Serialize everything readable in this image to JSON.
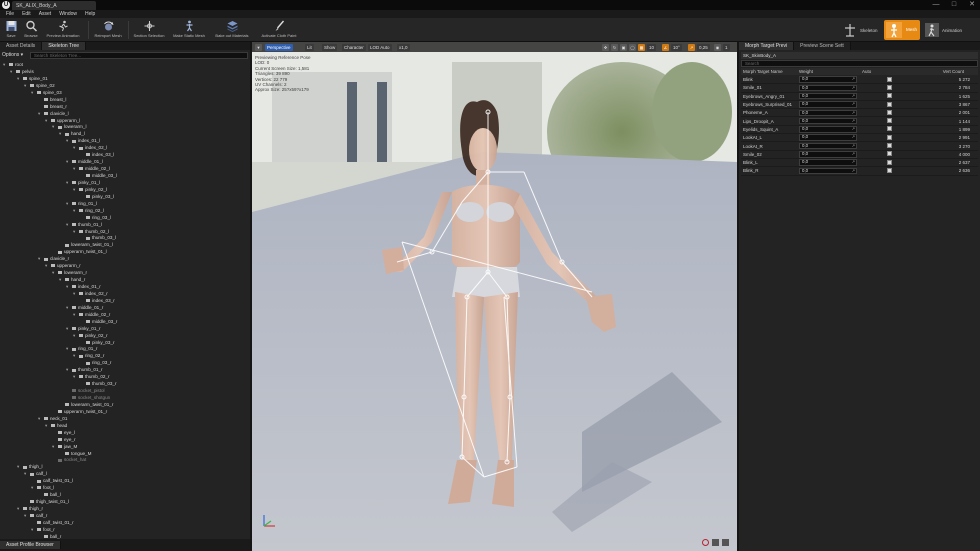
{
  "app": {
    "logo_letter": "U",
    "document_tab": "SK_ALIX_Body_A"
  },
  "menu": [
    "File",
    "Edit",
    "Asset",
    "Window",
    "Help"
  ],
  "toolbar": {
    "buttons": [
      "Save",
      "Browse",
      "Preview Animation",
      "Reimport Mesh",
      "Section Selection",
      "Make Static Mesh",
      "Bake out Materials",
      "Activate Cloth Paint"
    ],
    "modes": {
      "skeleton": "Skeleton",
      "mesh": "Mesh",
      "animation": "Animation"
    }
  },
  "left_panel": {
    "tabs": [
      "Asset Details",
      "Skeleton Tree"
    ],
    "options_label": "Options ▾",
    "search_placeholder": "Search Skeleton Tree...",
    "bottom_tab": "Asset Profile Browser",
    "tree": [
      {
        "label": "root",
        "depth": 0
      },
      {
        "label": "pelvis",
        "depth": 1
      },
      {
        "label": "spine_01",
        "depth": 2
      },
      {
        "label": "spine_02",
        "depth": 3
      },
      {
        "label": "spine_03",
        "depth": 4
      },
      {
        "label": "breast_l",
        "depth": 5
      },
      {
        "label": "breast_r",
        "depth": 5
      },
      {
        "label": "clavicle_l",
        "depth": 5
      },
      {
        "label": "upperarm_l",
        "depth": 6
      },
      {
        "label": "lowerarm_l",
        "depth": 7
      },
      {
        "label": "hand_l",
        "depth": 8
      },
      {
        "label": "index_01_l",
        "depth": 9
      },
      {
        "label": "index_02_l",
        "depth": 10
      },
      {
        "label": "index_03_l",
        "depth": 11
      },
      {
        "label": "middle_01_l",
        "depth": 9
      },
      {
        "label": "middle_02_l",
        "depth": 10
      },
      {
        "label": "middle_03_l",
        "depth": 11
      },
      {
        "label": "pinky_01_l",
        "depth": 9
      },
      {
        "label": "pinky_02_l",
        "depth": 10
      },
      {
        "label": "pinky_03_l",
        "depth": 11
      },
      {
        "label": "ring_01_l",
        "depth": 9
      },
      {
        "label": "ring_02_l",
        "depth": 10
      },
      {
        "label": "ring_03_l",
        "depth": 11
      },
      {
        "label": "thumb_01_l",
        "depth": 9
      },
      {
        "label": "thumb_02_l",
        "depth": 10
      },
      {
        "label": "thumb_03_l",
        "depth": 11
      },
      {
        "label": "lowerarm_twist_01_l",
        "depth": 8
      },
      {
        "label": "upperarm_twist_01_l",
        "depth": 7
      },
      {
        "label": "clavicle_r",
        "depth": 5
      },
      {
        "label": "upperarm_r",
        "depth": 6
      },
      {
        "label": "lowerarm_r",
        "depth": 7
      },
      {
        "label": "hand_r",
        "depth": 8
      },
      {
        "label": "index_01_r",
        "depth": 9
      },
      {
        "label": "index_02_r",
        "depth": 10
      },
      {
        "label": "index_03_r",
        "depth": 11
      },
      {
        "label": "middle_01_r",
        "depth": 9
      },
      {
        "label": "middle_02_r",
        "depth": 10
      },
      {
        "label": "middle_03_r",
        "depth": 11
      },
      {
        "label": "pinky_01_r",
        "depth": 9
      },
      {
        "label": "pinky_02_r",
        "depth": 10
      },
      {
        "label": "pinky_03_r",
        "depth": 11
      },
      {
        "label": "ring_01_r",
        "depth": 9
      },
      {
        "label": "ring_02_r",
        "depth": 10
      },
      {
        "label": "ring_03_r",
        "depth": 11
      },
      {
        "label": "thumb_01_r",
        "depth": 9
      },
      {
        "label": "thumb_02_r",
        "depth": 10
      },
      {
        "label": "thumb_03_r",
        "depth": 11
      },
      {
        "label": "socket_pistol",
        "depth": 9,
        "socket": true
      },
      {
        "label": "socket_shotgun",
        "depth": 9,
        "socket": true
      },
      {
        "label": "lowerarm_twist_01_r",
        "depth": 8
      },
      {
        "label": "upperarm_twist_01_r",
        "depth": 7
      },
      {
        "label": "neck_01",
        "depth": 5
      },
      {
        "label": "head",
        "depth": 6
      },
      {
        "label": "eye_l",
        "depth": 7
      },
      {
        "label": "eye_r",
        "depth": 7
      },
      {
        "label": "jaw_M",
        "depth": 7
      },
      {
        "label": "tongue_M",
        "depth": 8
      },
      {
        "label": "socket_hat",
        "depth": 7,
        "socket": true
      },
      {
        "label": "thigh_l",
        "depth": 2
      },
      {
        "label": "calf_l",
        "depth": 3
      },
      {
        "label": "calf_twist_01_l",
        "depth": 4
      },
      {
        "label": "foot_l",
        "depth": 4
      },
      {
        "label": "ball_l",
        "depth": 5
      },
      {
        "label": "thigh_twist_01_l",
        "depth": 3
      },
      {
        "label": "thigh_r",
        "depth": 2
      },
      {
        "label": "calf_r",
        "depth": 3
      },
      {
        "label": "calf_twist_01_r",
        "depth": 4
      },
      {
        "label": "foot_r",
        "depth": 4
      },
      {
        "label": "ball_r",
        "depth": 5
      }
    ]
  },
  "viewport": {
    "buttons": [
      "Perspective",
      "Lit",
      "Show",
      "Character",
      "LOD Auto",
      "x1,0"
    ],
    "right_values": [
      "10",
      "10°",
      "0,25",
      "1"
    ],
    "info": [
      "Previewing Reference Pose",
      "LOD: 0",
      "Current Screen Size: 1,581",
      "Triangles: 39 890",
      "Vertices: 22 779",
      "UV Channels: 2",
      "Approx Size: 25?x59?x179"
    ]
  },
  "right_panel": {
    "tabs": [
      "Morph Target Previ",
      "Preview Scene Sett"
    ],
    "mesh_name": "SK_SkinBody_A",
    "search_placeholder": "Search",
    "columns": [
      "Morph Target Name",
      "Weight",
      "Auto",
      "Vert Count"
    ],
    "rows": [
      {
        "name": "Blink",
        "weight": "0,0",
        "auto": true,
        "count": "5 272"
      },
      {
        "name": "Smile_01",
        "weight": "0,0",
        "auto": true,
        "count": "2 784"
      },
      {
        "name": "Eyebrows_Angry_01",
        "weight": "0,0",
        "auto": true,
        "count": "1 625"
      },
      {
        "name": "Eyebrows_Surprised_01",
        "weight": "0,0",
        "auto": true,
        "count": "3 867"
      },
      {
        "name": "Phoneme_A",
        "weight": "0,0",
        "auto": true,
        "count": "2 001"
      },
      {
        "name": "Lips_Droopit_A",
        "weight": "0,0",
        "auto": true,
        "count": "1 144"
      },
      {
        "name": "Eyelids_Squint_A",
        "weight": "0,0",
        "auto": true,
        "count": "1 899"
      },
      {
        "name": "LookAt_L",
        "weight": "0,0",
        "auto": true,
        "count": "2 991"
      },
      {
        "name": "LookAt_R",
        "weight": "0,0",
        "auto": true,
        "count": "3 270"
      },
      {
        "name": "Smile_02",
        "weight": "0,0",
        "auto": true,
        "count": "4 000"
      },
      {
        "name": "Blink_L",
        "weight": "0,0",
        "auto": true,
        "count": "2 637"
      },
      {
        "name": "Blink_R",
        "weight": "0,0",
        "auto": true,
        "count": "2 636"
      }
    ]
  },
  "colors": {
    "accent_orange": "#e78a14",
    "perspective_blue": "#2f5fae"
  }
}
